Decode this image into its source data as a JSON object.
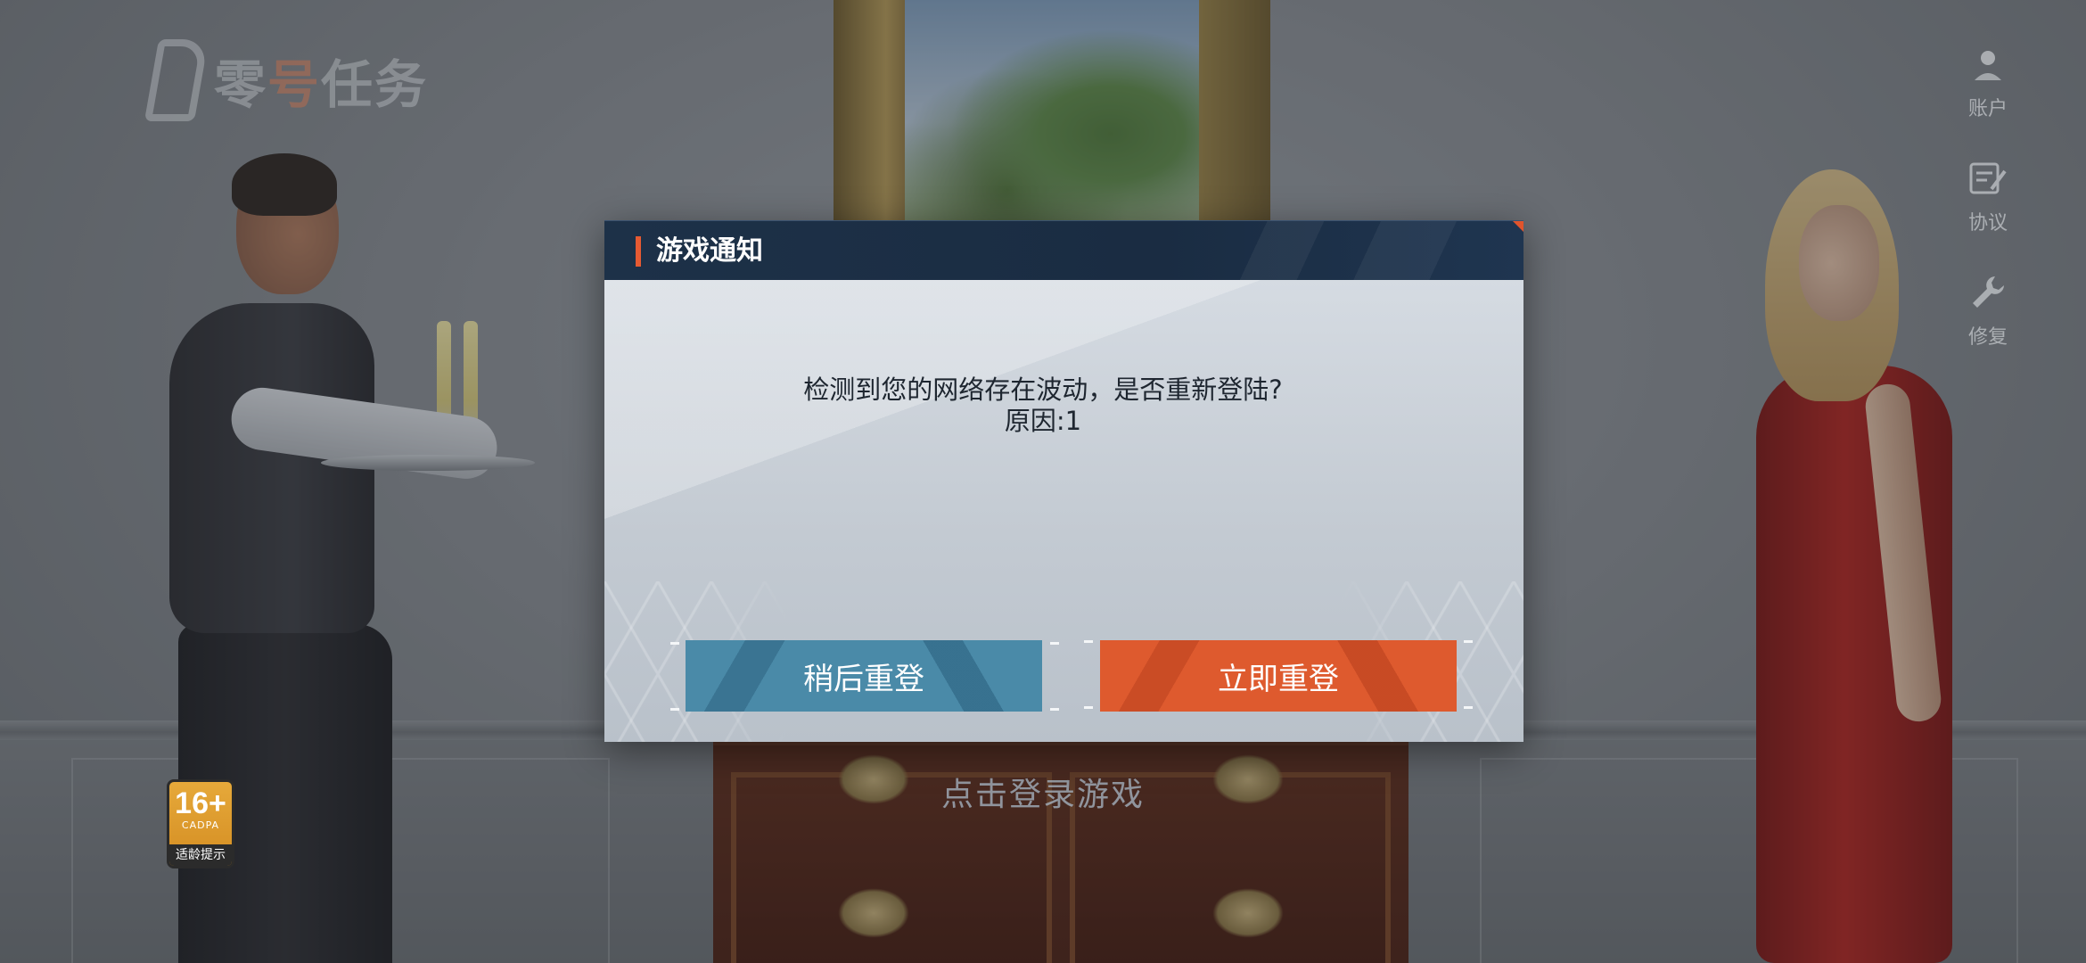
{
  "logo": {
    "text_a": "零",
    "text_accent": "号",
    "text_b": "任务"
  },
  "side_menu": [
    {
      "label": "账户",
      "icon": "user-icon"
    },
    {
      "label": "协议",
      "icon": "document-edit-icon"
    },
    {
      "label": "修复",
      "icon": "wrench-icon"
    }
  ],
  "age_rating": {
    "age": "16+",
    "org": "CADPA",
    "tip": "适龄提示"
  },
  "tap_login": "点击登录游戏",
  "dialog": {
    "title": "游戏通知",
    "message_line1": "检测到您的网络存在波动，是否重新登陆?",
    "message_line2": "原因:1",
    "later_button": "稍后重登",
    "now_button": "立即重登"
  },
  "colors": {
    "accent_orange": "#de5a2e",
    "button_blue": "#4a8aa8",
    "header_navy": "#1d3148"
  }
}
